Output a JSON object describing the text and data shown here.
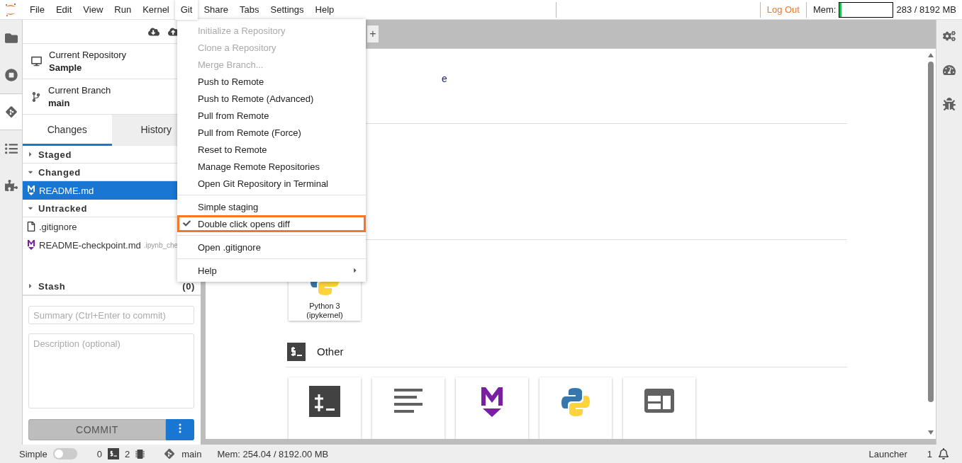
{
  "menubar": {
    "items": [
      {
        "label": "File",
        "selected": false
      },
      {
        "label": "Edit",
        "selected": false
      },
      {
        "label": "View",
        "selected": false
      },
      {
        "label": "Run",
        "selected": false
      },
      {
        "label": "Kernel",
        "selected": false
      },
      {
        "label": "Git",
        "selected": true
      },
      {
        "label": "Share",
        "selected": false
      },
      {
        "label": "Tabs",
        "selected": false
      },
      {
        "label": "Settings",
        "selected": false
      },
      {
        "label": "Help",
        "selected": false
      }
    ],
    "logout": "Log Out",
    "mem_label": "Mem:",
    "mem_meter": {
      "level": 0.035
    },
    "mem_reading": "283 / 8192 MB"
  },
  "left_bar": [
    {
      "kind": "folder",
      "selected": false
    },
    {
      "kind": "running",
      "selected": false
    },
    {
      "kind": "git",
      "selected": true
    },
    {
      "kind": "toc",
      "selected": false
    },
    {
      "kind": "extensions",
      "selected": false
    }
  ],
  "right_bar": [
    {
      "kind": "property"
    },
    {
      "kind": "gauge"
    },
    {
      "kind": "debugger"
    }
  ],
  "sidebar": {
    "repository": {
      "label": "Current Repository",
      "value": "Sample"
    },
    "branch": {
      "label": "Current Branch",
      "value": "main"
    },
    "tabs": [
      {
        "label": "Changes",
        "selected": true
      },
      {
        "label": "History",
        "selected": false
      }
    ],
    "sections": [
      {
        "title": "Staged",
        "expanded": false
      },
      {
        "title": "Changed",
        "expanded": true,
        "files": [
          {
            "name": "README.md",
            "kind": "markdown",
            "selected": true
          }
        ]
      },
      {
        "title": "Untracked",
        "expanded": true,
        "files": [
          {
            "name": ".gitignore",
            "kind": "file",
            "selected": false
          },
          {
            "name": "README-checkpoint.md",
            "path": ".ipynb_che",
            "kind": "markdown",
            "selected": false
          }
        ]
      },
      {
        "title": "Stash",
        "expanded": false,
        "count": "(0)"
      }
    ],
    "summary_placeholder": "Summary (Ctrl+Enter to commit)",
    "description_placeholder": "Description (optional)",
    "commit_button": "COMMIT"
  },
  "main": {
    "new_tab": "+",
    "fragment": "e",
    "kernel_card": {
      "label": "Python 3 (ipykernel)"
    },
    "other_title": "Other",
    "other_cards": [
      {
        "kind": "terminal"
      },
      {
        "kind": "text"
      },
      {
        "kind": "markdown"
      },
      {
        "kind": "python"
      },
      {
        "kind": "window"
      }
    ]
  },
  "git_menu": [
    {
      "kind": "item",
      "label": "Initialize a Repository",
      "disabled": true
    },
    {
      "kind": "item",
      "label": "Clone a Repository",
      "disabled": true
    },
    {
      "kind": "item",
      "label": "Merge Branch...",
      "disabled": true
    },
    {
      "kind": "item",
      "label": "Push to Remote",
      "disabled": false
    },
    {
      "kind": "item",
      "label": "Push to Remote (Advanced)",
      "disabled": false
    },
    {
      "kind": "item",
      "label": "Pull from Remote",
      "disabled": false
    },
    {
      "kind": "item",
      "label": "Pull from Remote (Force)",
      "disabled": false
    },
    {
      "kind": "item",
      "label": "Reset to Remote",
      "disabled": false
    },
    {
      "kind": "item",
      "label": "Manage Remote Repositories",
      "disabled": false
    },
    {
      "kind": "item",
      "label": "Open Git Repository in Terminal",
      "disabled": false
    },
    {
      "kind": "separator"
    },
    {
      "kind": "check",
      "label": "Simple staging",
      "disabled": false,
      "checked": false,
      "highlighted": false
    },
    {
      "kind": "check",
      "label": "Double click opens diff",
      "disabled": false,
      "checked": true,
      "highlighted": true
    },
    {
      "kind": "separator"
    },
    {
      "kind": "item",
      "label": "Open .gitignore",
      "disabled": false
    },
    {
      "kind": "separator"
    },
    {
      "kind": "submenu",
      "label": "Help",
      "disabled": false
    }
  ],
  "status_bar": {
    "simple": {
      "label": "Simple",
      "on": false
    },
    "terminals": "0",
    "kernels": "2",
    "branch": "main",
    "memory": "Mem: 254.04 / 8192.00 MB",
    "launcher": "Launcher",
    "notifications": "1"
  }
}
